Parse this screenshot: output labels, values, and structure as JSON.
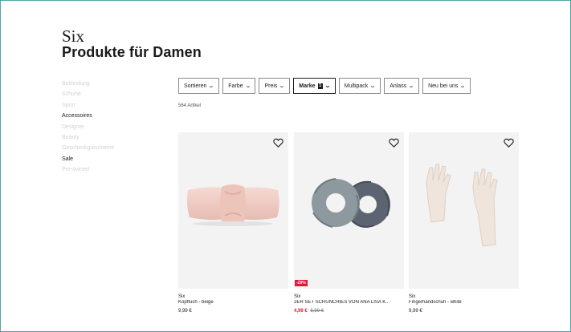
{
  "header": {
    "brand": "Six",
    "title": "Produkte für Damen"
  },
  "sidebar": {
    "items": [
      {
        "label": "Bekleidung",
        "active": false
      },
      {
        "label": "Schuhe",
        "active": false
      },
      {
        "label": "Sport",
        "active": false
      },
      {
        "label": "Accessoires",
        "active": true
      },
      {
        "label": "Designer",
        "active": false
      },
      {
        "label": "Beauty",
        "active": false
      },
      {
        "label": "Geschenkgutscheine",
        "active": false
      },
      {
        "label": "Sale",
        "active": true
      },
      {
        "label": "Pre-owned",
        "active": false
      }
    ]
  },
  "filters": {
    "sort": "Sortieren",
    "color": "Farbe",
    "price": "Preis",
    "brand": "Marke",
    "brand_count": "1",
    "multipack": "Multipack",
    "occasion": "Anlass",
    "new": "Neu bei uns"
  },
  "results": {
    "count": "564 Artikel"
  },
  "products": [
    {
      "brand": "Six",
      "name": "Kopftuch - beige",
      "price": "9,99 €",
      "old_price": "",
      "discount": ""
    },
    {
      "brand": "Six",
      "name": "2ER SET SCRUNCHIES VON ANA LISA K...",
      "price": "4,99 €",
      "old_price": "6,99 €",
      "discount": "-29%"
    },
    {
      "brand": "Six",
      "name": "Fingerhandschuh - white",
      "price": "9,99 €",
      "old_price": "",
      "discount": ""
    }
  ],
  "colors": {
    "sale": "#e3183a",
    "frame": "#4fa3a8"
  }
}
